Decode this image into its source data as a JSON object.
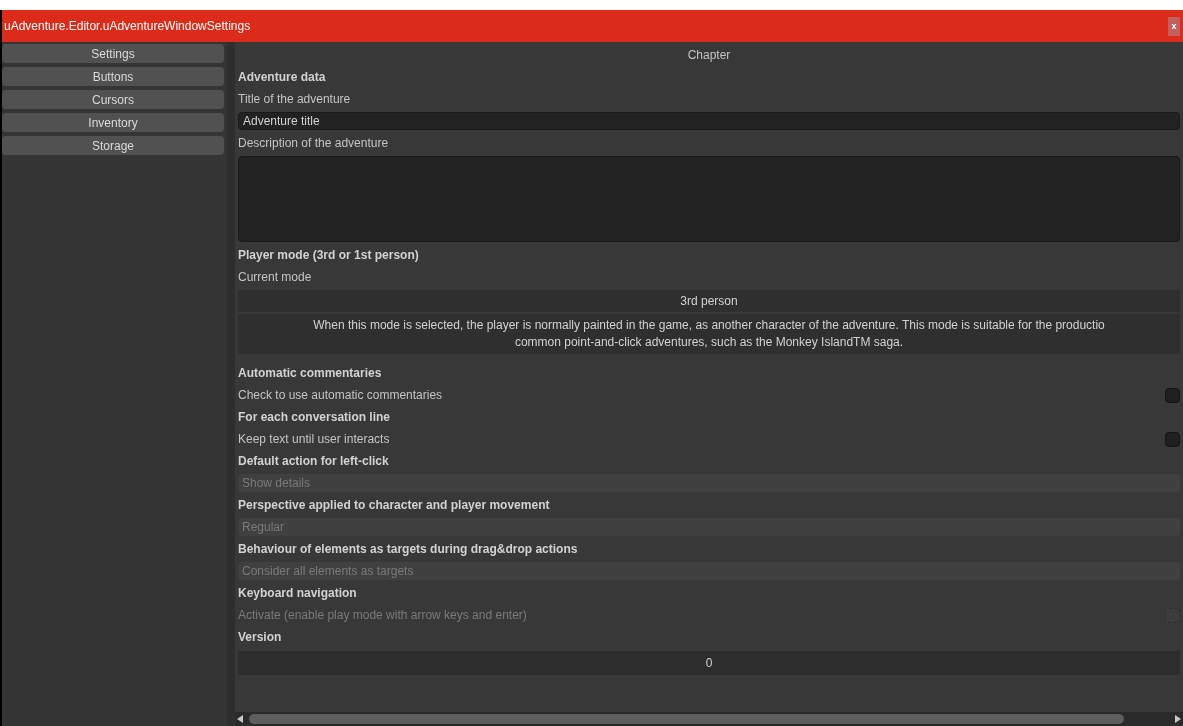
{
  "window": {
    "title": "uAdventure.Editor.uAdventureWindowSettings",
    "close": "x"
  },
  "sidebar": {
    "items": [
      {
        "label": "Settings",
        "selected": false
      },
      {
        "label": "Buttons",
        "selected": false
      },
      {
        "label": "Cursors",
        "selected": false
      },
      {
        "label": "Inventory",
        "selected": false
      },
      {
        "label": "Storage",
        "selected": false
      }
    ]
  },
  "panel": {
    "title": "Chapter",
    "rows": [
      {
        "kind": "heading",
        "text": "Adventure data"
      },
      {
        "kind": "label",
        "text": "Title of the adventure"
      },
      {
        "kind": "field",
        "value": "Adventure title",
        "disabled": false
      },
      {
        "kind": "label",
        "text": "Description of the adventure"
      },
      {
        "kind": "textarea"
      },
      {
        "kind": "heading",
        "text": "Player mode (3rd or 1st person)"
      },
      {
        "kind": "label",
        "text": "Current mode"
      },
      {
        "kind": "selector",
        "value": "3rd person"
      },
      {
        "kind": "note",
        "lines": [
          "When this mode is selected, the player is normally painted in the game, as another character of the adventure. This mode is suitable for the productio",
          "common point-and-click adventures, such as the Monkey IslandTM saga."
        ]
      },
      {
        "kind": "heading",
        "text": "Automatic commentaries"
      },
      {
        "kind": "check",
        "text": "Check to use automatic commentaries",
        "checked": false,
        "disabled": false
      },
      {
        "kind": "heading",
        "text": "For each conversation line"
      },
      {
        "kind": "check",
        "text": "Keep text until user interacts",
        "checked": false,
        "disabled": false
      },
      {
        "kind": "heading",
        "text": "Default action for left-click"
      },
      {
        "kind": "field",
        "value": "Show details",
        "disabled": true
      },
      {
        "kind": "heading",
        "text": "Perspective applied to character and player movement"
      },
      {
        "kind": "field",
        "value": "Regular",
        "disabled": true
      },
      {
        "kind": "heading",
        "text": "Behaviour of elements as targets during drag&drop actions"
      },
      {
        "kind": "field",
        "value": "Consider all elements as targets",
        "disabled": true
      },
      {
        "kind": "heading",
        "text": "Keyboard navigation"
      },
      {
        "kind": "check",
        "text": "Activate (enable play mode with arrow keys and enter)",
        "checked": false,
        "disabled": true
      },
      {
        "kind": "heading",
        "text": "Version"
      },
      {
        "kind": "number",
        "value": "0"
      }
    ]
  }
}
